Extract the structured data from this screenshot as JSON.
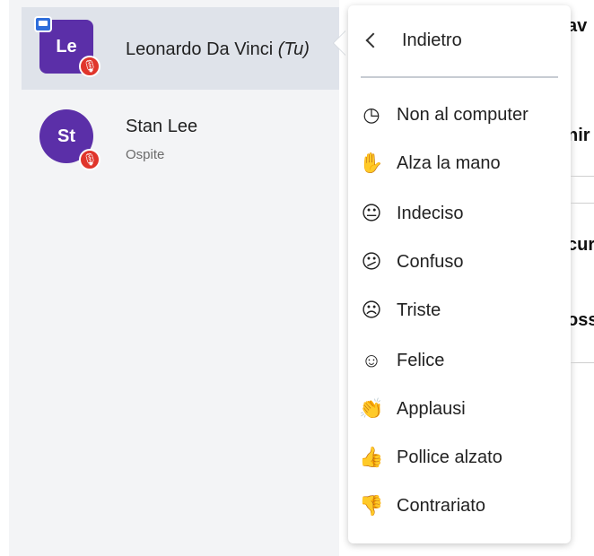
{
  "users": [
    {
      "initials": "Le",
      "name": "Leonardo Da Vinci",
      "you_suffix": "(Tu)",
      "role": ""
    },
    {
      "initials": "St",
      "name": "Stan Lee",
      "you_suffix": "",
      "role": "Ospite"
    }
  ],
  "menu": {
    "back_label": "Indietro",
    "items": [
      {
        "label": "Non al computer",
        "icon": "clock-icon",
        "glyph": "◷"
      },
      {
        "label": "Alza la mano",
        "icon": "raised-hand-icon",
        "glyph": "✋"
      },
      {
        "label": "Indeciso",
        "icon": "neutral-face-icon",
        "glyph": "😐"
      },
      {
        "label": "Confuso",
        "icon": "confused-face-icon",
        "glyph": "😕"
      },
      {
        "label": "Triste",
        "icon": "sad-face-icon",
        "glyph": "☹"
      },
      {
        "label": "Felice",
        "icon": "happy-face-icon",
        "glyph": "☺"
      },
      {
        "label": "Applausi",
        "icon": "applause-icon",
        "glyph": "👏"
      },
      {
        "label": "Pollice alzato",
        "icon": "thumbs-up-icon",
        "glyph": "👍"
      },
      {
        "label": "Contrariato",
        "icon": "thumbs-down-icon",
        "glyph": "👎"
      }
    ]
  },
  "background_fragments": [
    "av",
    "nir",
    "cur",
    "oss"
  ],
  "colors": {
    "avatar": "#5b2fa8",
    "mic_muted": "#e0352b",
    "presenter": "#2f6edb",
    "selected_row": "#dfe3ea"
  }
}
